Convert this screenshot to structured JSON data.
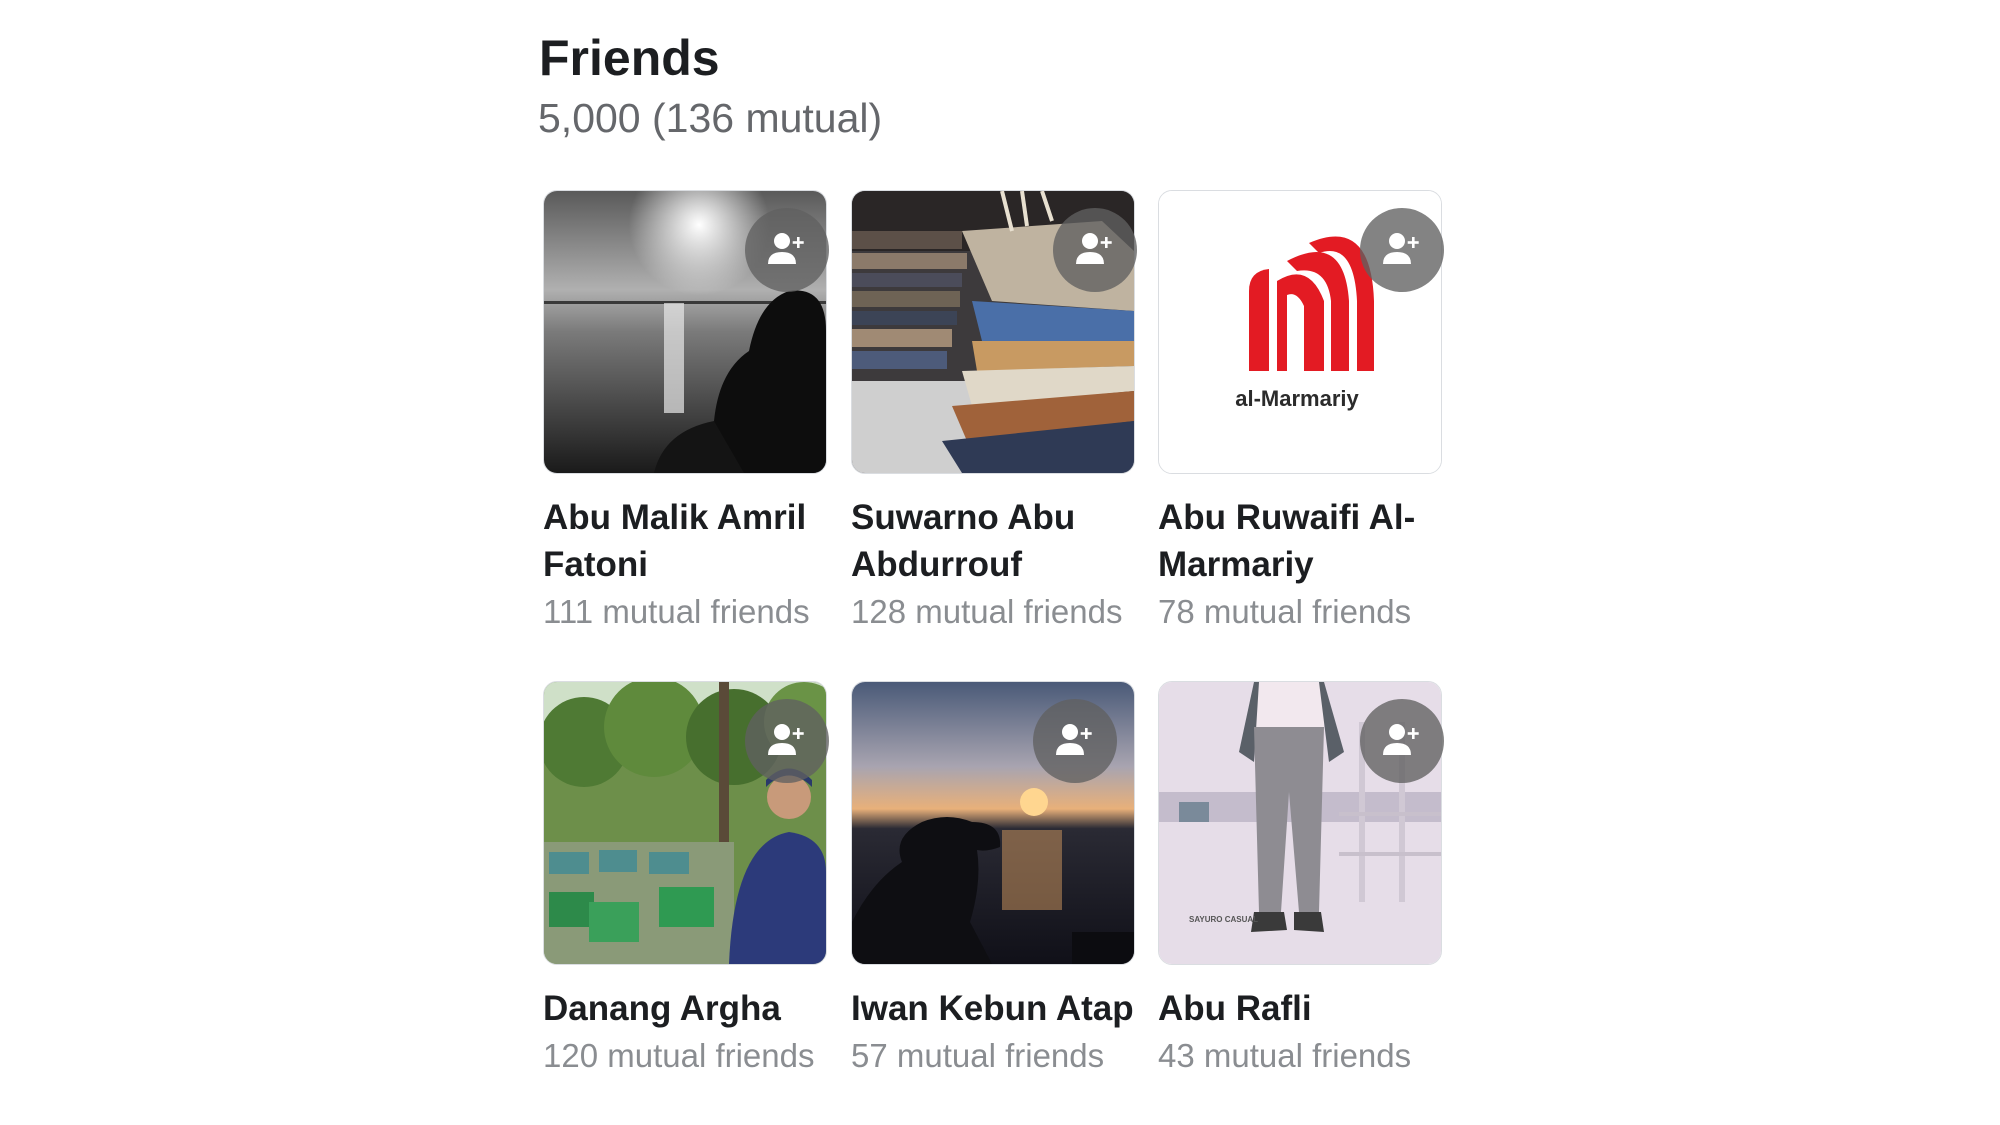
{
  "friends": {
    "title": "Friends",
    "count_text": "5,000 (136 mutual)",
    "add_friend_icon": "person-plus-icon",
    "items": [
      {
        "name": "Abu Malik Amril Fatoni",
        "mutual": "111 mutual friends",
        "photo": "sunset-over-sea-silhouette"
      },
      {
        "name": "Suwarno Abu Abdurrouf",
        "mutual": "128 mutual friends",
        "photo": "stacked-fabric-bundles"
      },
      {
        "name": "Abu Ruwaifi Al-Marmariy",
        "mutual": "78 mutual friends",
        "photo": "al-marmariy-logo",
        "logo_text": "al-Marmariy"
      },
      {
        "name": "Danang Argha",
        "mutual": "120 mutual friends",
        "photo": "man-in-garden-with-beehives"
      },
      {
        "name": "Iwan Kebun Atap",
        "mutual": "57 mutual friends",
        "photo": "hat-silhouette-at-sunset"
      },
      {
        "name": "Abu Rafli",
        "mutual": "43 mutual friends",
        "photo": "fashion-pants-photo",
        "photo_caption": "SAYURO CASUAL"
      }
    ]
  },
  "colors": {
    "title": "#1c1e21",
    "subtitle": "#65676b",
    "mutual": "#8a8d91",
    "logo_red": "#e31b23",
    "add_button_bg": "#606060"
  }
}
